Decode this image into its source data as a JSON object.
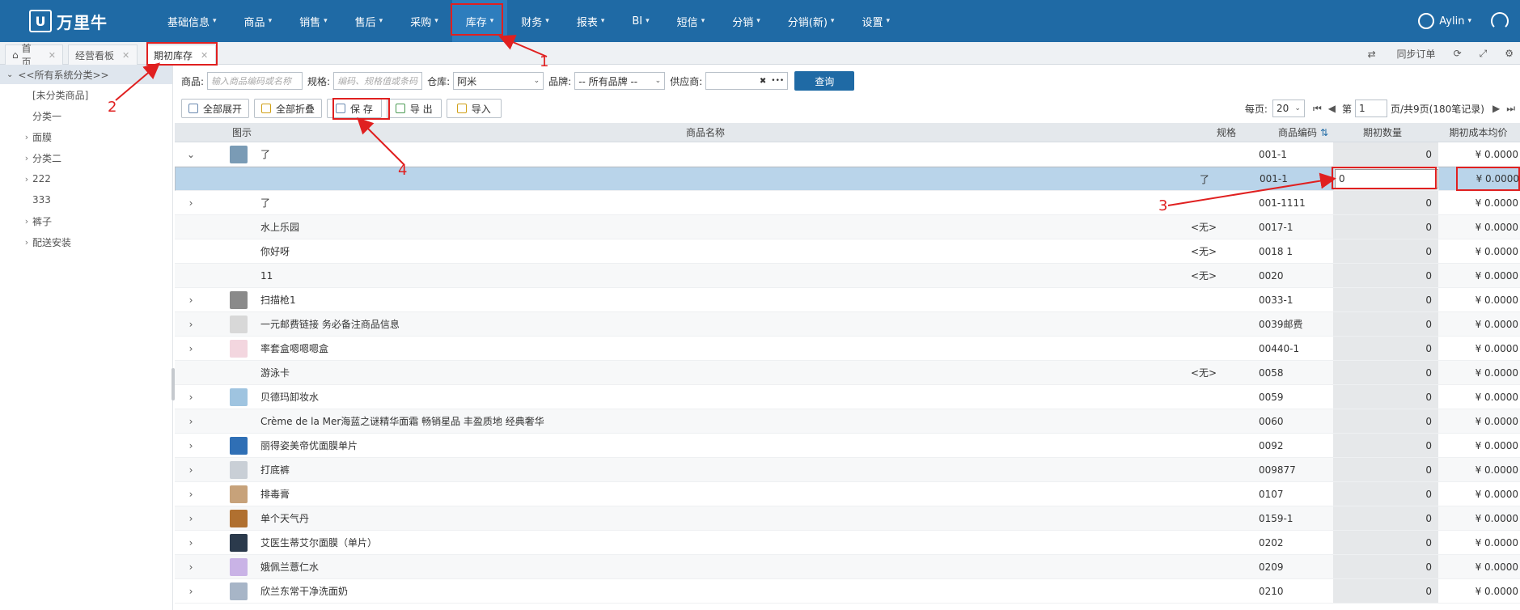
{
  "app": {
    "logo_text": "万里牛",
    "logo_mark": "U"
  },
  "nav": {
    "items": [
      {
        "label": "基础信息"
      },
      {
        "label": "商品"
      },
      {
        "label": "销售"
      },
      {
        "label": "售后"
      },
      {
        "label": "采购"
      },
      {
        "label": "库存"
      },
      {
        "label": "财务"
      },
      {
        "label": "报表"
      },
      {
        "label": "BI"
      },
      {
        "label": "短信"
      },
      {
        "label": "分销"
      },
      {
        "label": "分销(新)"
      },
      {
        "label": "设置"
      }
    ],
    "active": "库存",
    "user": "Aylin"
  },
  "tabs": [
    {
      "label": "首页"
    },
    {
      "label": "经营看板"
    },
    {
      "label": "期初库存"
    }
  ],
  "tab_tools": {
    "sync": "同步订单"
  },
  "sidebar": {
    "root": "<<所有系统分类>>",
    "items": [
      {
        "label": "[未分类商品]",
        "expandable": false
      },
      {
        "label": "分类一",
        "expandable": false
      },
      {
        "label": "面膜",
        "expandable": true
      },
      {
        "label": "分类二",
        "expandable": true
      },
      {
        "label": "222",
        "expandable": true
      },
      {
        "label": "333",
        "expandable": false
      },
      {
        "label": "裤子",
        "expandable": true
      },
      {
        "label": "配送安装",
        "expandable": true
      }
    ]
  },
  "filter": {
    "product_label": "商品:",
    "product_placeholder": "输入商品编码或名称",
    "spec_label": "规格:",
    "spec_placeholder": "编码、规格值或条码",
    "warehouse_label": "仓库:",
    "warehouse_value": "阿米",
    "brand_label": "品牌:",
    "brand_value": "-- 所有品牌 --",
    "supplier_label": "供应商:",
    "supplier_clear": "✖",
    "supplier_more": "•••",
    "query_button": "查询"
  },
  "toolbar": {
    "expand_all": "全部展开",
    "collapse_all": "全部折叠",
    "save": "保 存",
    "export": "导 出",
    "import": "导入"
  },
  "pager": {
    "per_page_label": "每页:",
    "per_page": "20",
    "page_label": "第",
    "page": "1",
    "summary": "页/共9页(180笔记录)"
  },
  "grid": {
    "headers": {
      "image": "图示",
      "name": "商品名称",
      "spec": "规格",
      "code": "商品编码",
      "qty": "期初数量",
      "cost": "期初成本均价"
    },
    "rows": [
      {
        "exp": "⌄",
        "img": "#7a9bb5",
        "name": "了",
        "spec": "",
        "code": "001-1",
        "qty": "0",
        "cost": "¥ 0.0000"
      },
      {
        "exp": "",
        "img": "",
        "name": "",
        "spec": "了",
        "code": "001-1",
        "qty": "0",
        "cost": "¥ 0.0000",
        "selected": true
      },
      {
        "exp": "›",
        "img": "",
        "name": "了",
        "spec": "",
        "code": "001-1111",
        "qty": "0",
        "cost": "¥ 0.0000"
      },
      {
        "exp": "",
        "img": "",
        "name": "水上乐园",
        "spec": "<无>",
        "code": "0017-1",
        "qty": "0",
        "cost": "¥ 0.0000"
      },
      {
        "exp": "",
        "img": "",
        "name": "你好呀",
        "spec": "<无>",
        "code": "0018 1",
        "qty": "0",
        "cost": "¥ 0.0000"
      },
      {
        "exp": "",
        "img": "",
        "name": "11",
        "spec": "<无>",
        "code": "0020",
        "qty": "0",
        "cost": "¥ 0.0000"
      },
      {
        "exp": "›",
        "img": "#8a8a8a",
        "name": "扫描枪1",
        "spec": "",
        "code": "0033-1",
        "qty": "0",
        "cost": "¥ 0.0000"
      },
      {
        "exp": "›",
        "img": "#d8d8d8",
        "name": "一元邮费链接 务必备注商品信息",
        "spec": "",
        "code": "0039邮费",
        "qty": "0",
        "cost": "¥ 0.0000"
      },
      {
        "exp": "›",
        "img": "#f3d6df",
        "name": "率套盒嗯嗯嗯盒",
        "spec": "",
        "code": "00440-1",
        "qty": "0",
        "cost": "¥ 0.0000"
      },
      {
        "exp": "",
        "img": "",
        "name": "游泳卡",
        "spec": "<无>",
        "code": "0058",
        "qty": "0",
        "cost": "¥ 0.0000"
      },
      {
        "exp": "›",
        "img": "#9fc4e0",
        "name": "贝德玛卸妆水",
        "spec": "",
        "code": "0059",
        "qty": "0",
        "cost": "¥ 0.0000"
      },
      {
        "exp": "›",
        "img": "",
        "name": "Crème de la Mer海蓝之谜精华面霜 畅销星品 丰盈质地 经典奢华",
        "spec": "",
        "code": "0060",
        "qty": "0",
        "cost": "¥ 0.0000"
      },
      {
        "exp": "›",
        "img": "#2f6fb5",
        "name": "丽得姿美帝优面膜单片",
        "spec": "",
        "code": "0092",
        "qty": "0",
        "cost": "¥ 0.0000"
      },
      {
        "exp": "›",
        "img": "#c9cfd6",
        "name": "打底裤",
        "spec": "",
        "code": "009877",
        "qty": "0",
        "cost": "¥ 0.0000"
      },
      {
        "exp": "›",
        "img": "#c7a27a",
        "name": "排毒膏",
        "spec": "",
        "code": "0107",
        "qty": "0",
        "cost": "¥ 0.0000"
      },
      {
        "exp": "›",
        "img": "#b07030",
        "name": "单个天气丹",
        "spec": "",
        "code": "0159-1",
        "qty": "0",
        "cost": "¥ 0.0000"
      },
      {
        "exp": "›",
        "img": "#2b3a4c",
        "name": "艾医生蒂艾尔面膜（单片）",
        "spec": "",
        "code": "0202",
        "qty": "0",
        "cost": "¥ 0.0000"
      },
      {
        "exp": "›",
        "img": "#c9b3e6",
        "name": "娥佩兰薏仁水",
        "spec": "",
        "code": "0209",
        "qty": "0",
        "cost": "¥ 0.0000"
      },
      {
        "exp": "›",
        "img": "#a7b5c7",
        "name": "欣兰东常干净洗面奶",
        "spec": "",
        "code": "0210",
        "qty": "0",
        "cost": "¥ 0.0000"
      }
    ]
  },
  "edit_value": "0",
  "annotations": [
    "1",
    "2",
    "3",
    "4"
  ],
  "colors": {
    "brand": "#1f6aa5",
    "annotation": "#e02020",
    "selected_row": "#b9d4ea"
  }
}
